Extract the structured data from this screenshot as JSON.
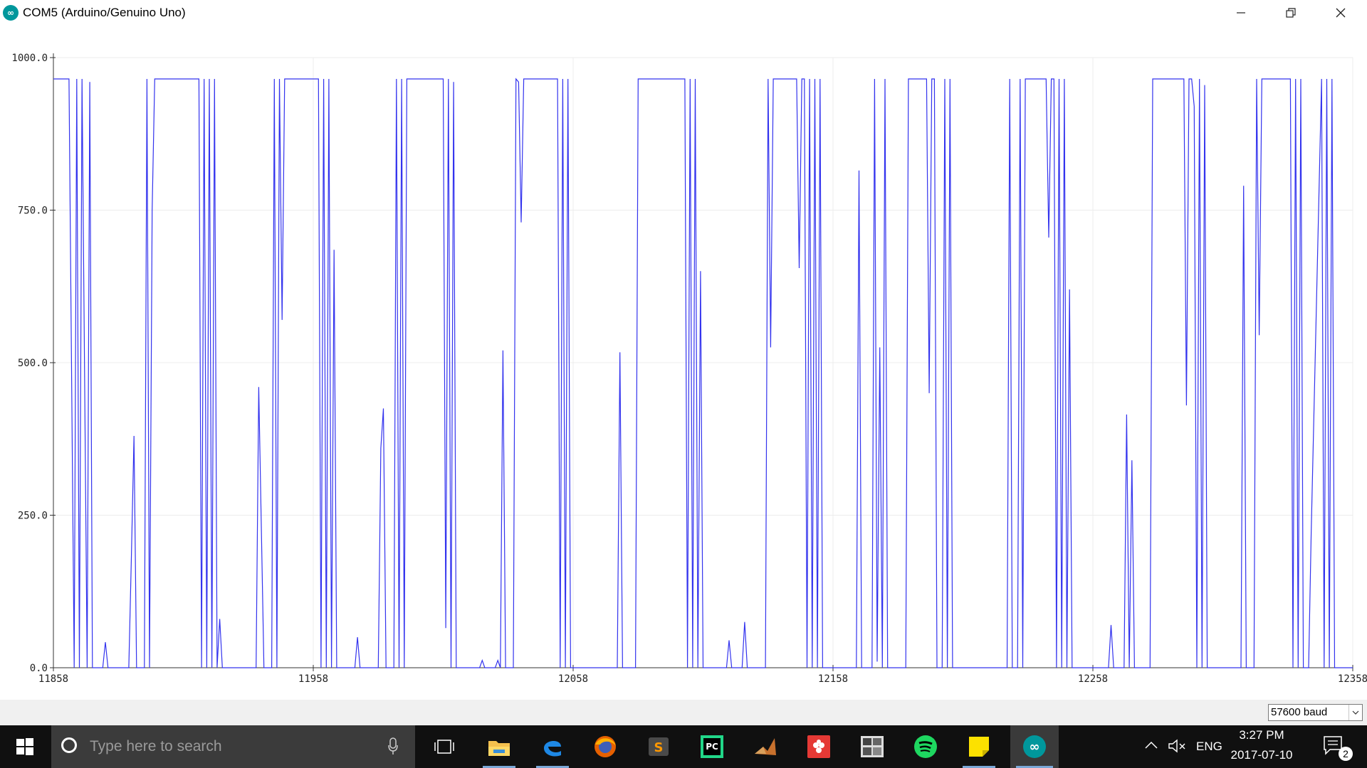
{
  "window": {
    "title": "COM5 (Arduino/Genuino Uno)",
    "minimize_glyph": "—",
    "restore_glyph": "❐",
    "close_glyph": "✕"
  },
  "colors": {
    "series": "#3333ee",
    "grid": "#ececec",
    "axis": "#333333",
    "bottom_bar": "#f0f0f0",
    "taskbar": "#101010"
  },
  "chart_data": {
    "type": "line",
    "title": "",
    "xlabel": "",
    "ylabel": "",
    "xlim": [
      11858,
      12358
    ],
    "ylim": [
      0,
      1000
    ],
    "x_ticks": [
      11858,
      11958,
      12058,
      12158,
      12258,
      12358
    ],
    "y_ticks": [
      "0.0",
      "250.0",
      "500.0",
      "750.0",
      "1000.0"
    ],
    "x_tick_labels": [
      "11858",
      "11958",
      "12058",
      "12158",
      "12258",
      "12358"
    ],
    "grid": true,
    "legend": "none",
    "series": [
      {
        "values": [
          [
            11858,
            965
          ],
          [
            11864,
            965
          ],
          [
            11866,
            0
          ],
          [
            11867,
            965
          ],
          [
            11868,
            0
          ],
          [
            11869,
            965
          ],
          [
            11871,
            0
          ],
          [
            11872,
            960
          ],
          [
            11873,
            0
          ],
          [
            11877,
            0
          ],
          [
            11878,
            42
          ],
          [
            11879,
            0
          ],
          [
            11887,
            0
          ],
          [
            11888,
            180
          ],
          [
            11889,
            380
          ],
          [
            11890,
            0
          ],
          [
            11893,
            0
          ],
          [
            11894,
            965
          ],
          [
            11895,
            0
          ],
          [
            11896,
            750
          ],
          [
            11897,
            965
          ],
          [
            11914,
            965
          ],
          [
            11915,
            0
          ],
          [
            11916,
            965
          ],
          [
            11917,
            0
          ],
          [
            11918,
            965
          ],
          [
            11919,
            0
          ],
          [
            11920,
            965
          ],
          [
            11921,
            0
          ],
          [
            11922,
            80
          ],
          [
            11923,
            0
          ],
          [
            11936,
            0
          ],
          [
            11937,
            460
          ],
          [
            11939,
            0
          ],
          [
            11942,
            0
          ],
          [
            11943,
            965
          ],
          [
            11944,
            0
          ],
          [
            11945,
            965
          ],
          [
            11946,
            570
          ],
          [
            11947,
            965
          ],
          [
            11948,
            965
          ],
          [
            11960,
            965
          ],
          [
            11961,
            0
          ],
          [
            11962,
            965
          ],
          [
            11963,
            0
          ],
          [
            11964,
            965
          ],
          [
            11965,
            0
          ],
          [
            11966,
            685
          ],
          [
            11967,
            0
          ],
          [
            11974,
            0
          ],
          [
            11975,
            50
          ],
          [
            11976,
            0
          ],
          [
            11983,
            0
          ],
          [
            11984,
            360
          ],
          [
            11985,
            425
          ],
          [
            11986,
            0
          ],
          [
            11989,
            0
          ],
          [
            11990,
            965
          ],
          [
            11991,
            0
          ],
          [
            11992,
            965
          ],
          [
            11993,
            0
          ],
          [
            11994,
            965
          ],
          [
            12008,
            965
          ],
          [
            12009,
            65
          ],
          [
            12010,
            965
          ],
          [
            12011,
            0
          ],
          [
            12012,
            960
          ],
          [
            12013,
            0
          ],
          [
            12022,
            0
          ],
          [
            12023,
            12
          ],
          [
            12024,
            0
          ],
          [
            12028,
            0
          ],
          [
            12029,
            12
          ],
          [
            12030,
            0
          ],
          [
            12031,
            520
          ],
          [
            12032,
            0
          ],
          [
            12035,
            0
          ],
          [
            12036,
            965
          ],
          [
            12037,
            960
          ],
          [
            12038,
            730
          ],
          [
            12039,
            965
          ],
          [
            12052,
            965
          ],
          [
            12053,
            0
          ],
          [
            12054,
            965
          ],
          [
            12055,
            0
          ],
          [
            12056,
            965
          ],
          [
            12057,
            0
          ],
          [
            12059,
            0
          ],
          [
            12061,
            0
          ],
          [
            12075,
            0
          ],
          [
            12076,
            517
          ],
          [
            12077,
            0
          ],
          [
            12082,
            0
          ],
          [
            12083,
            965
          ],
          [
            12101,
            965
          ],
          [
            12102,
            0
          ],
          [
            12103,
            965
          ],
          [
            12104,
            0
          ],
          [
            12105,
            965
          ],
          [
            12106,
            0
          ],
          [
            12107,
            650
          ],
          [
            12108,
            0
          ],
          [
            12117,
            0
          ],
          [
            12118,
            45
          ],
          [
            12119,
            0
          ],
          [
            12123,
            0
          ],
          [
            12124,
            75
          ],
          [
            12125,
            0
          ],
          [
            12132,
            0
          ],
          [
            12133,
            965
          ],
          [
            12134,
            525
          ],
          [
            12135,
            965
          ],
          [
            12144,
            965
          ],
          [
            12145,
            655
          ],
          [
            12146,
            965
          ],
          [
            12147,
            965
          ],
          [
            12148,
            0
          ],
          [
            12149,
            965
          ],
          [
            12150,
            0
          ],
          [
            12151,
            965
          ],
          [
            12152,
            0
          ],
          [
            12153,
            965
          ],
          [
            12154,
            0
          ],
          [
            12167,
            0
          ],
          [
            12168,
            815
          ],
          [
            12169,
            0
          ],
          [
            12173,
            0
          ],
          [
            12174,
            965
          ],
          [
            12175,
            10
          ],
          [
            12176,
            525
          ],
          [
            12177,
            0
          ],
          [
            12178,
            965
          ],
          [
            12179,
            0
          ],
          [
            12186,
            0
          ],
          [
            12187,
            965
          ],
          [
            12194,
            965
          ],
          [
            12195,
            450
          ],
          [
            12196,
            965
          ],
          [
            12197,
            965
          ],
          [
            12198,
            0
          ],
          [
            12200,
            0
          ],
          [
            12201,
            965
          ],
          [
            12202,
            0
          ],
          [
            12203,
            965
          ],
          [
            12204,
            0
          ],
          [
            12225,
            0
          ],
          [
            12226,
            965
          ],
          [
            12227,
            0
          ],
          [
            12229,
            0
          ],
          [
            12230,
            965
          ],
          [
            12231,
            0
          ],
          [
            12232,
            965
          ],
          [
            12233,
            965
          ],
          [
            12240,
            965
          ],
          [
            12241,
            705
          ],
          [
            12242,
            965
          ],
          [
            12243,
            965
          ],
          [
            12244,
            0
          ],
          [
            12245,
            965
          ],
          [
            12246,
            0
          ],
          [
            12247,
            965
          ],
          [
            12248,
            0
          ],
          [
            12249,
            620
          ],
          [
            12250,
            0
          ],
          [
            12264,
            0
          ],
          [
            12265,
            70
          ],
          [
            12266,
            0
          ],
          [
            12270,
            0
          ],
          [
            12271,
            415
          ],
          [
            12272,
            0
          ],
          [
            12273,
            340
          ],
          [
            12274,
            0
          ],
          [
            12280,
            0
          ],
          [
            12281,
            965
          ],
          [
            12293,
            965
          ],
          [
            12294,
            430
          ],
          [
            12295,
            965
          ],
          [
            12296,
            965
          ],
          [
            12297,
            920
          ],
          [
            12298,
            0
          ],
          [
            12299,
            965
          ],
          [
            12300,
            0
          ],
          [
            12301,
            955
          ],
          [
            12302,
            0
          ],
          [
            12315,
            0
          ],
          [
            12316,
            790
          ],
          [
            12317,
            0
          ],
          [
            12320,
            0
          ],
          [
            12321,
            965
          ],
          [
            12322,
            545
          ],
          [
            12323,
            965
          ],
          [
            12334,
            965
          ],
          [
            12335,
            0
          ],
          [
            12336,
            965
          ],
          [
            12337,
            0
          ],
          [
            12338,
            965
          ],
          [
            12339,
            0
          ],
          [
            12341,
            0
          ],
          [
            12342,
            220
          ],
          [
            12345,
            775
          ],
          [
            12346,
            965
          ],
          [
            12347,
            0
          ],
          [
            12348,
            965
          ],
          [
            12349,
            0
          ],
          [
            12350,
            965
          ],
          [
            12351,
            0
          ],
          [
            12358,
            0
          ]
        ]
      }
    ]
  },
  "bottom": {
    "baud_value": "57600 baud"
  },
  "taskbar": {
    "search_placeholder": "Type here to search",
    "apps": [
      {
        "name": "task-view-icon"
      },
      {
        "name": "file-explorer-icon"
      },
      {
        "name": "edge-browser-icon"
      },
      {
        "name": "firefox-icon"
      },
      {
        "name": "sublime-text-icon"
      },
      {
        "name": "pycharm-icon"
      },
      {
        "name": "matlab-icon"
      },
      {
        "name": "raspberry-icon"
      },
      {
        "name": "calculator-grid-icon"
      },
      {
        "name": "spotify-icon"
      },
      {
        "name": "sticky-notes-icon"
      },
      {
        "name": "arduino-icon"
      }
    ],
    "tray": {
      "language": "ENG",
      "time": "3:27 PM",
      "date": "2017-07-10",
      "notification_count": "2"
    }
  }
}
